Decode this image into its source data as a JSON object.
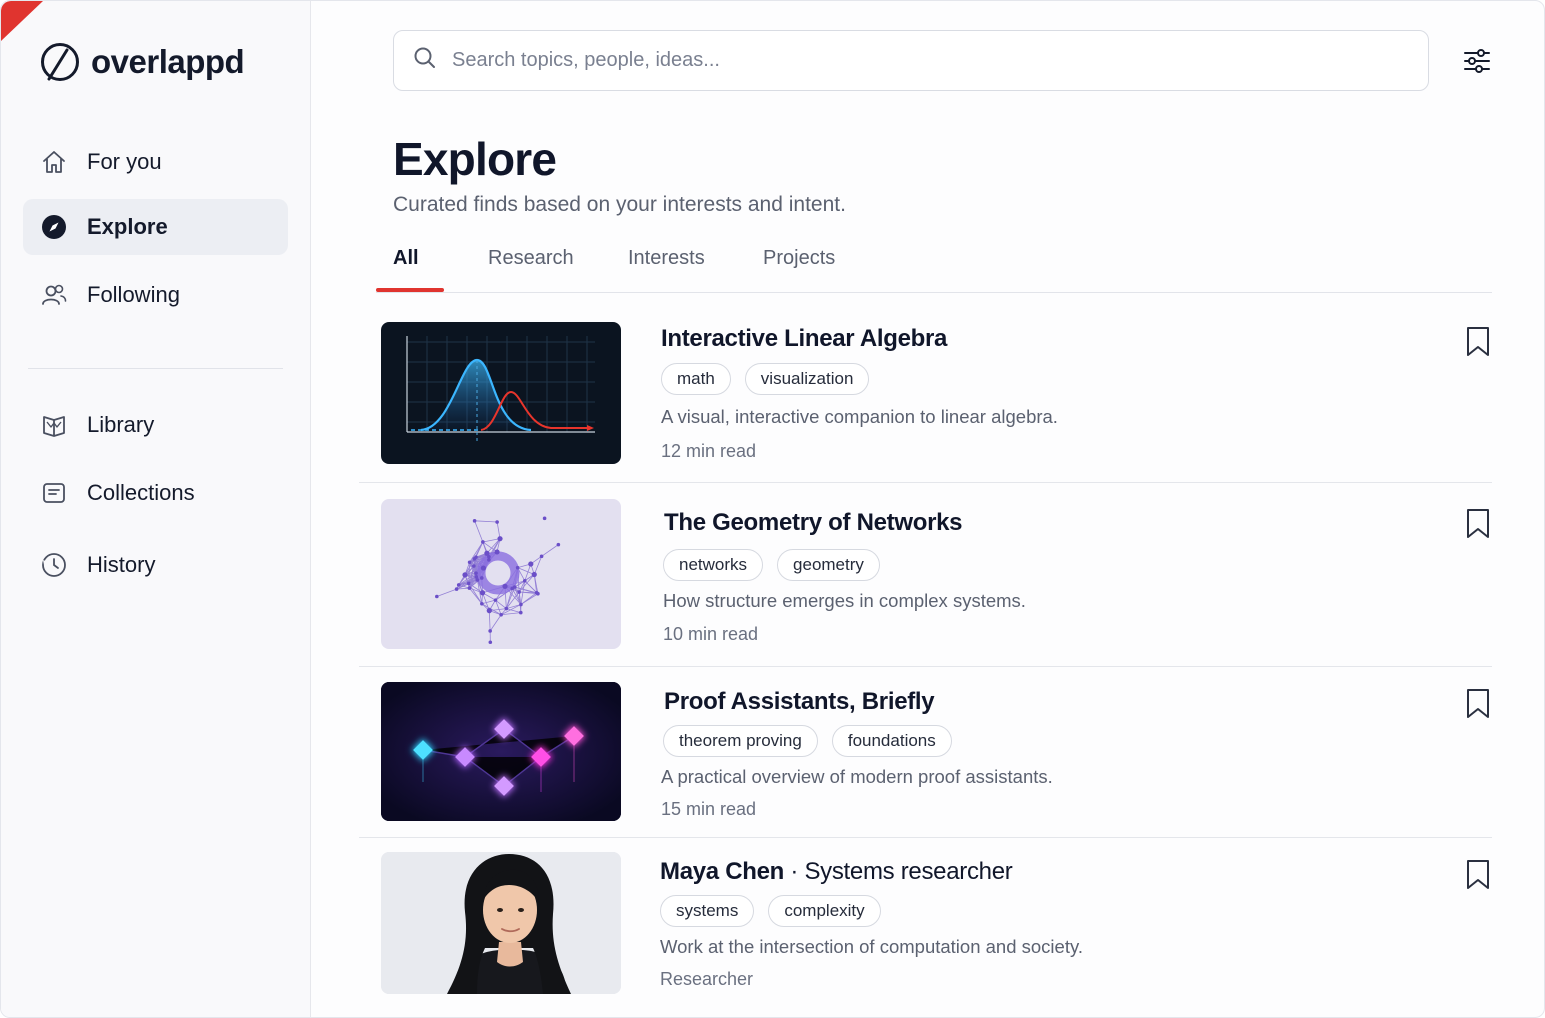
{
  "brand": {
    "name": "overlappd"
  },
  "nav": {
    "primary": [
      {
        "label": "For you",
        "icon": "home-icon"
      },
      {
        "label": "Explore",
        "icon": "compass-icon",
        "active": true
      },
      {
        "label": "Following",
        "icon": "people-icon"
      }
    ],
    "secondary": [
      {
        "label": "Library",
        "icon": "book-icon"
      },
      {
        "label": "Collections",
        "icon": "collection-icon"
      },
      {
        "label": "History",
        "icon": "history-icon"
      }
    ]
  },
  "search": {
    "placeholder": "Search topics, people, ideas..."
  },
  "header": {
    "title": "Explore",
    "subtitle": "Curated finds based on your interests and intent."
  },
  "tabs": [
    {
      "label": "All",
      "active": true
    },
    {
      "label": "Research"
    },
    {
      "label": "Interests"
    },
    {
      "label": "Projects"
    }
  ],
  "feed": [
    {
      "title": "Interactive Linear Algebra",
      "tags": [
        "math",
        "visualization"
      ],
      "description": "A visual, interactive companion to linear algebra.",
      "meta": "12 min read",
      "thumbnail": "distribution-plot-thumbnail"
    },
    {
      "title": "The Geometry of Networks",
      "tags": [
        "networks",
        "geometry"
      ],
      "description": "How structure emerges in complex systems.",
      "meta": "10 min read",
      "thumbnail": "network-graph-thumbnail"
    },
    {
      "title": "Proof Assistants, Briefly",
      "tags": [
        "theorem proving",
        "foundations"
      ],
      "description": "A practical overview of modern proof assistants.",
      "meta": "15 min read",
      "thumbnail": "glowing-nodes-thumbnail"
    },
    {
      "title": "Maya Chen",
      "role": "· Systems researcher",
      "tags": [
        "systems",
        "complexity"
      ],
      "description": "Work at the intersection of computation and society.",
      "meta": "Researcher",
      "thumbnail": "person-portrait-thumbnail"
    }
  ],
  "colors": {
    "accent": "#e0342f",
    "text": "#10162a",
    "muted": "#5b6170",
    "active_nav_bg": "#eceef3"
  }
}
